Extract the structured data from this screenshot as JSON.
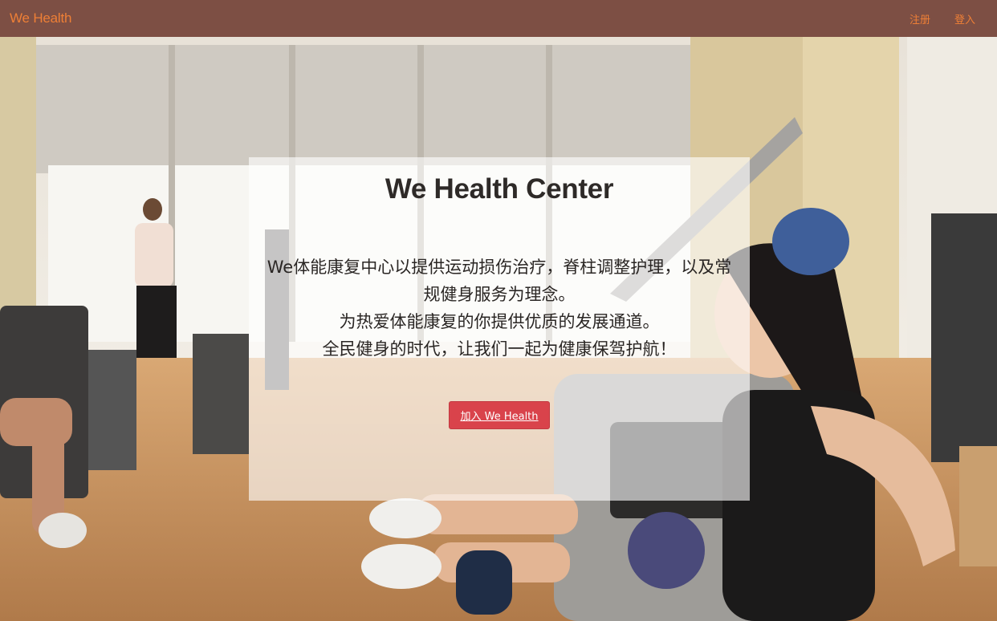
{
  "navbar": {
    "brand": "We Health",
    "links": [
      "注册",
      "登入"
    ]
  },
  "hero": {
    "title": "We Health Center",
    "lines": [
      "We体能康复中心以提供运动损伤治疗，脊柱调整护理，以及常规健身服务为理念。",
      "为热爱体能康复的你提供优质的发展通道。",
      "全民健身的时代，让我们一起为健康保驾护航！"
    ],
    "join_button": "加入 We Health"
  },
  "colors": {
    "navbar_bg": "#7d4f44",
    "brand_orange": "#ee7f36",
    "button_red": "#d9434b"
  }
}
